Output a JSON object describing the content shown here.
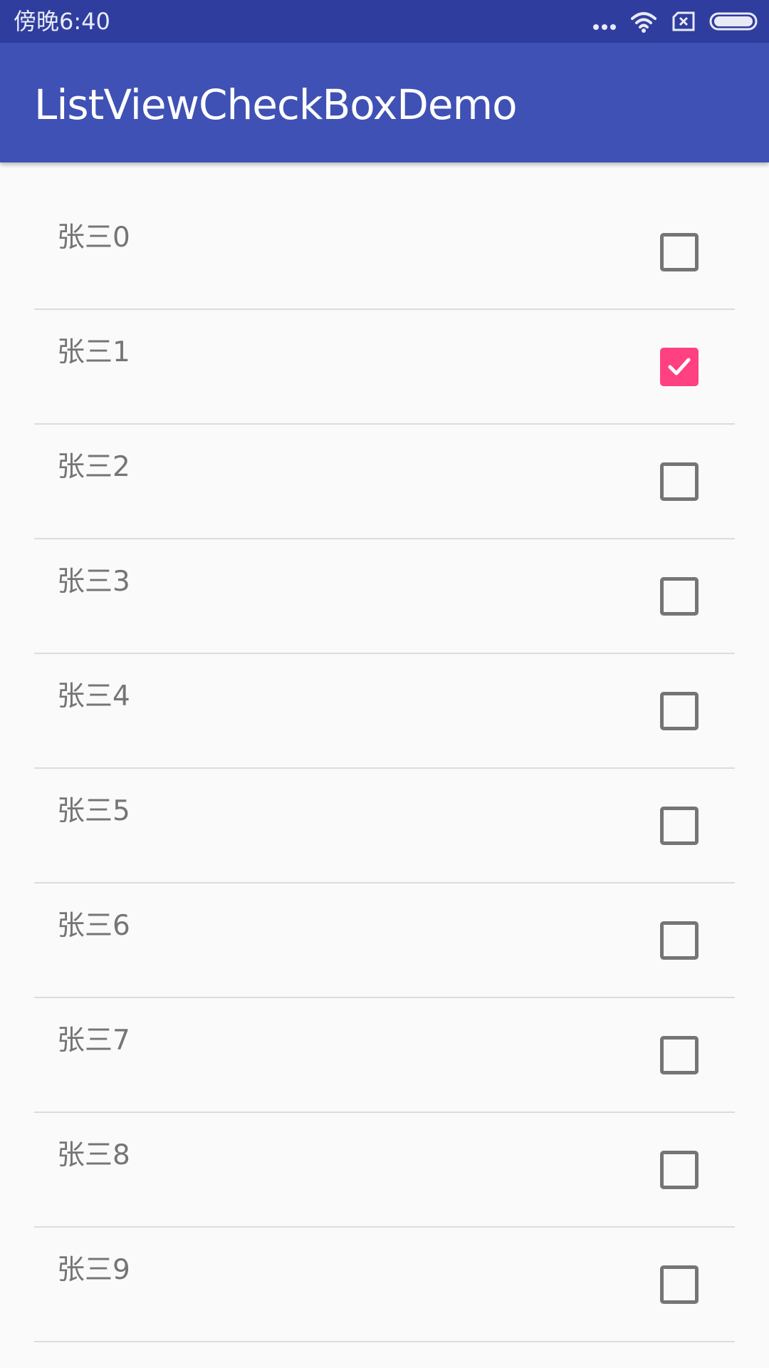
{
  "status_bar": {
    "time": "傍晚6:40",
    "icons": [
      "more-dots-icon",
      "wifi-icon",
      "sim-icon",
      "battery-icon"
    ]
  },
  "app_bar": {
    "title": "ListViewCheckBoxDemo",
    "color": "#3f51b5"
  },
  "colors": {
    "status_bar": "#2f3e9e",
    "accent": "#ff4081",
    "unchecked": "#757575",
    "background": "#fafafa"
  },
  "list": {
    "items": [
      {
        "label": "张三0",
        "checked": false
      },
      {
        "label": "张三1",
        "checked": true
      },
      {
        "label": "张三2",
        "checked": false
      },
      {
        "label": "张三3",
        "checked": false
      },
      {
        "label": "张三4",
        "checked": false
      },
      {
        "label": "张三5",
        "checked": false
      },
      {
        "label": "张三6",
        "checked": false
      },
      {
        "label": "张三7",
        "checked": false
      },
      {
        "label": "张三8",
        "checked": false
      },
      {
        "label": "张三9",
        "checked": false
      }
    ]
  }
}
